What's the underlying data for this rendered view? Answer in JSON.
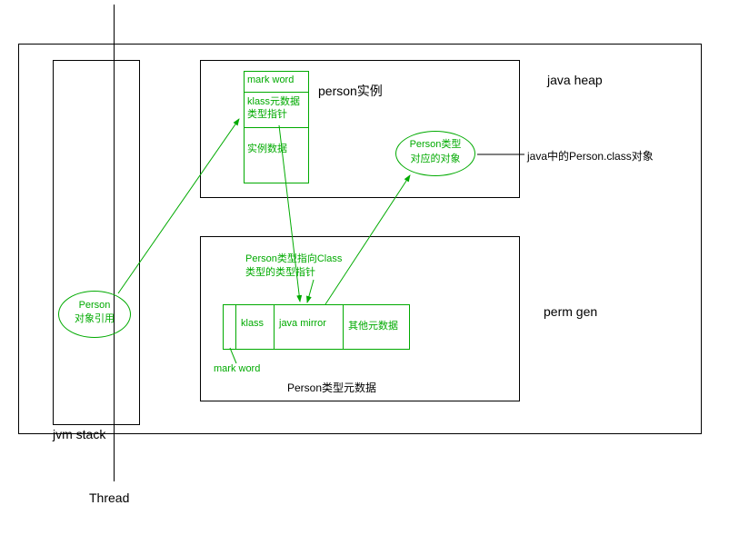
{
  "outer": {
    "jvm_stack_label": "jvm stack",
    "thread_label": "Thread"
  },
  "heap": {
    "label": "java heap",
    "person_instance_label": "person实例",
    "mark_word": "mark word",
    "klass_meta": "klass元数据类型指针",
    "instance_data": "实例数据",
    "person_type_line1": "Person类型",
    "person_type_line2": "对应的对象",
    "person_class_label": "java中的Person.class对象"
  },
  "perm": {
    "label": "perm gen",
    "ptr_text_line1": "Person类型指向Class",
    "ptr_text_line2": "类型的类型指针",
    "klass": "klass",
    "java_mirror": "java mirror",
    "other_meta": "其他元数据",
    "mark_word_label": "mark word",
    "meta_table_label": "Person类型元数据"
  },
  "stack": {
    "ref_line1": "Person",
    "ref_line2": "对象引用"
  }
}
